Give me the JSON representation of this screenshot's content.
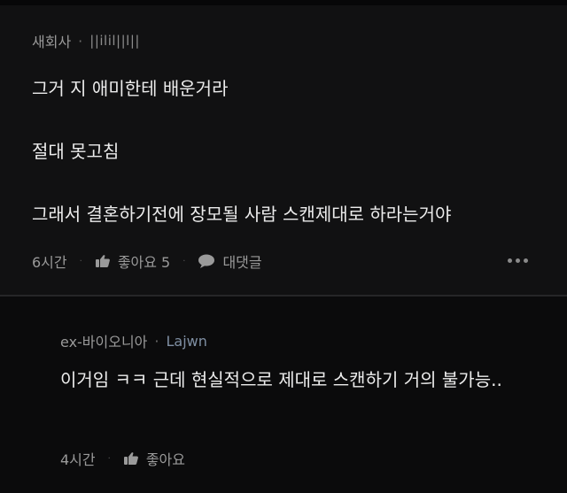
{
  "comment": {
    "author": "새회사",
    "author_separator": "·",
    "author_tag": "||ilil||l||",
    "lines": [
      "그거 지 애미한테 배운거라",
      "절대 못고침",
      "그래서 결혼하기전에 장모될 사람 스캔제대로 하라는거야"
    ],
    "time": "6시간",
    "separator": "·",
    "like_label": "좋아요 5",
    "reply_label": "대댓글",
    "icons": {
      "like": "thumbs-up-icon",
      "reply": "speech-bubble-icon",
      "more": "more-dots-icon"
    }
  },
  "reply": {
    "author": "ex-바이오니아",
    "author_separator": "·",
    "author_tag": "Lajwn",
    "text": "이거임 ㅋㅋ 근데 현실적으로 제대로 스캔하기 거의 불가능..",
    "time": "4시간",
    "separator": "·",
    "like_label": "좋아요"
  },
  "colors": {
    "background": "#111112",
    "reply_background": "#0b0b0c",
    "text": "#ececec",
    "muted": "#9a9a9a"
  }
}
